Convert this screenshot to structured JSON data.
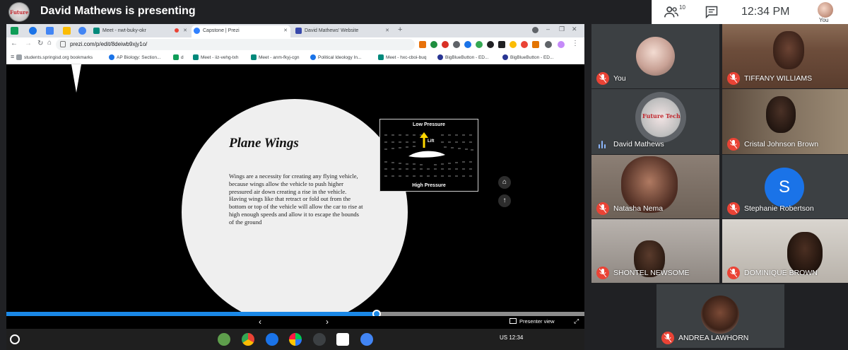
{
  "meet": {
    "presenter_logo_text": "Future Technologies",
    "presenting_title": "David Mathews is presenting",
    "participant_count": "10",
    "time": "12:34 PM",
    "you_label": "You"
  },
  "browser": {
    "tabs": [
      {
        "label": "Meet - nwt-buky-okr"
      },
      {
        "label": "Capstone | Prezi"
      },
      {
        "label": "David Mathews' Website"
      }
    ],
    "new_tab": "+",
    "url": "prezi.com/p/edit/8deiwb9xjy1o/",
    "bookmarks": [
      {
        "label": "students.springisd.org bookmarks"
      },
      {
        "label": "AP Biology: Section..."
      },
      {
        "label": "d"
      },
      {
        "label": "Meet - iiz-vehg-txh"
      },
      {
        "label": "Meet - anm-fkyj-cgn"
      },
      {
        "label": "Political Ideology In..."
      },
      {
        "label": "Meet - hxc-cboi-buq"
      },
      {
        "label": "BigBlueButton - ED..."
      },
      {
        "label": "BigBlueButton - ED..."
      }
    ]
  },
  "slide": {
    "title": "Plane Wings",
    "body": "Wings are a necessity for creating any flying vehicle, because wings allow the vehicle to push higher pressured air down creating a rise in the vehicle. Having wings like that retract or fold out from the bottom or top of the vehicle will allow the car to rise at high enough speeds and allow it to escape the bounds of the ground",
    "diagram": {
      "top_label": "Low Pressure",
      "bottom_label": "High Pressure",
      "arrow_label": "Lift"
    },
    "progress_fraction": 0.64
  },
  "prezi": {
    "presenter_view": "Presenter view",
    "prev": "‹",
    "next": "›"
  },
  "shelf": {
    "tray": "US  12:34"
  },
  "participants": [
    {
      "name": "You",
      "muted": true
    },
    {
      "name": "TIFFANY WILLIAMS",
      "muted": true
    },
    {
      "name": "David Mathews",
      "muted": false
    },
    {
      "name": "Cristal Johnson Brown",
      "muted": true
    },
    {
      "name": "Natasha Nema",
      "muted": true
    },
    {
      "name": "Stephanie Robertson",
      "muted": true,
      "initial": "S",
      "avatar_color": "#1a73e8"
    },
    {
      "name": "SHONTEL NEWSOME",
      "muted": true
    },
    {
      "name": "DOMINIQUE BROWN",
      "muted": true
    },
    {
      "name": "ANDREA LAWHORN",
      "muted": true
    }
  ],
  "colors": {
    "meet_bg": "#202124",
    "mic_muted": "#ea4335",
    "progress": "#1a88e6"
  }
}
